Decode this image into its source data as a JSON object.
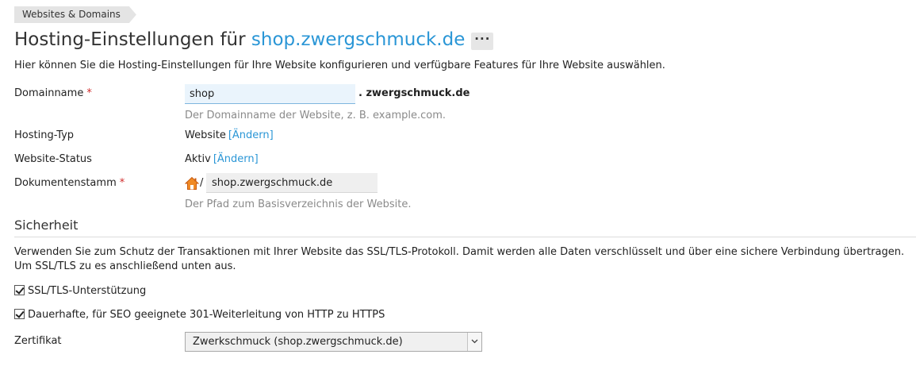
{
  "breadcrumb": {
    "label": "Websites & Domains"
  },
  "header": {
    "title_prefix": "Hosting-Einstellungen für",
    "domain": "shop.zwergschmuck.de",
    "more_label": "···"
  },
  "intro": "Hier können Sie die Hosting-Einstellungen für Ihre Website konfigurieren und verfügbare Features für Ihre Website auswählen.",
  "form": {
    "required_marker": "*",
    "domain_name": {
      "label": "Domainname",
      "value": "shop",
      "suffix": ". zwergschmuck.de",
      "hint": "Der Domainname der Website, z. B. example.com."
    },
    "hosting_type": {
      "label": "Hosting-Typ",
      "value": "Website",
      "change_link": "[Ändern]"
    },
    "website_status": {
      "label": "Website-Status",
      "value": "Aktiv",
      "change_link": "[Ändern]"
    },
    "document_root": {
      "label": "Dokumentenstamm",
      "icon": "home-icon",
      "separator": "/",
      "value": "shop.zwergschmuck.de",
      "hint": "Der Pfad zum Basisverzeichnis der Website."
    }
  },
  "security": {
    "title": "Sicherheit",
    "description": "Verwenden Sie zum Schutz der Transaktionen mit Ihrer Website das SSL/TLS-Protokoll. Damit werden alle Daten verschlüsselt und über eine sichere Verbindung übertragen. Um SSL/TLS zu es anschließend unten aus.",
    "ssl_support": {
      "label": "SSL/TLS-Unterstützung",
      "checked": true
    },
    "redirect": {
      "label": "Dauerhafte, für SEO geeignete 301-Weiterleitung von HTTP zu HTTPS",
      "checked": true
    },
    "certificate": {
      "label": "Zertifikat",
      "selected": "Zwerkschmuck (shop.zwergschmuck.de)"
    }
  },
  "colors": {
    "link": "#2a96d6",
    "required": "#d02b2b",
    "hint": "#8a8a8a"
  }
}
